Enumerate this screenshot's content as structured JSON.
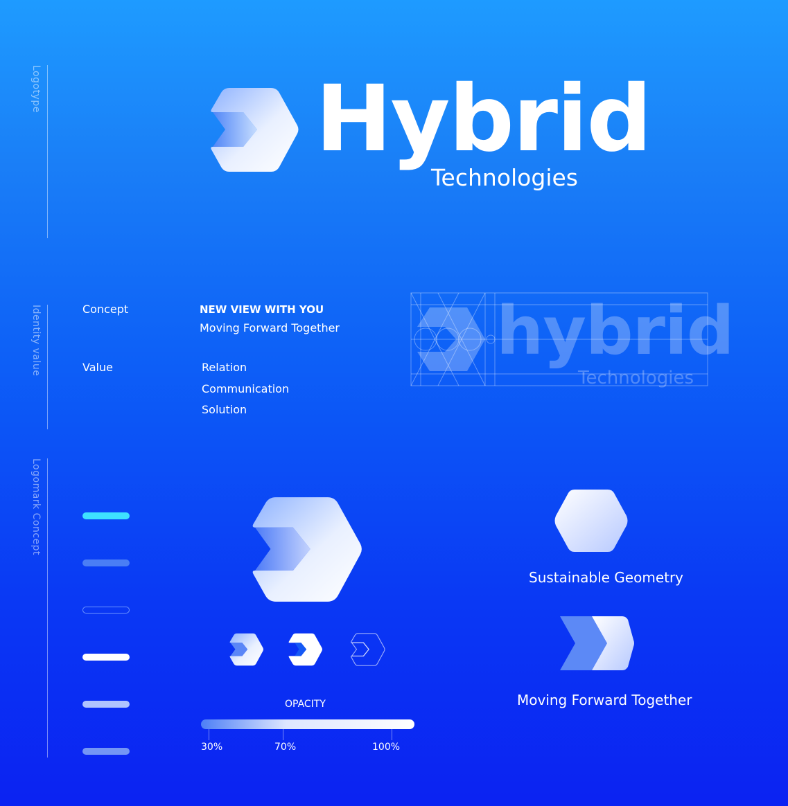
{
  "sections": {
    "logotype": "Logotype",
    "identity": "Identity value",
    "logomark": "Logomark Concept"
  },
  "brand": {
    "name": "Hybrid",
    "sub": "Technologies",
    "ghost_name": "hybrid",
    "ghost_sub": "Technologies"
  },
  "concept": {
    "label": "Concept",
    "headline": "NEW VIEW WITH YOU",
    "tagline": "Moving Forward Together"
  },
  "value": {
    "label": "Value",
    "items": [
      "Relation",
      "Communication",
      "Solution"
    ]
  },
  "swatches": [
    {
      "style": "cyan",
      "color": "#3ee0ff"
    },
    {
      "style": "mid-blue",
      "color": "#4a7ef5"
    },
    {
      "style": "outline",
      "color": "#6d95ff"
    },
    {
      "style": "white",
      "color": "#ffffff"
    },
    {
      "style": "pale",
      "color": "#b0c4ff"
    },
    {
      "style": "light-blue",
      "color": "#7496f5"
    }
  ],
  "opacity": {
    "title": "OPACITY",
    "labels": [
      "30%",
      "70%",
      "100%"
    ]
  },
  "concepts": {
    "geometry": "Sustainable Geometry",
    "forward": "Moving Forward Together"
  },
  "icons": {
    "main_logomark": "hexagon-chevron-logomark",
    "hexagon": "hexagon-icon",
    "chevrons": "double-chevron-icon"
  }
}
